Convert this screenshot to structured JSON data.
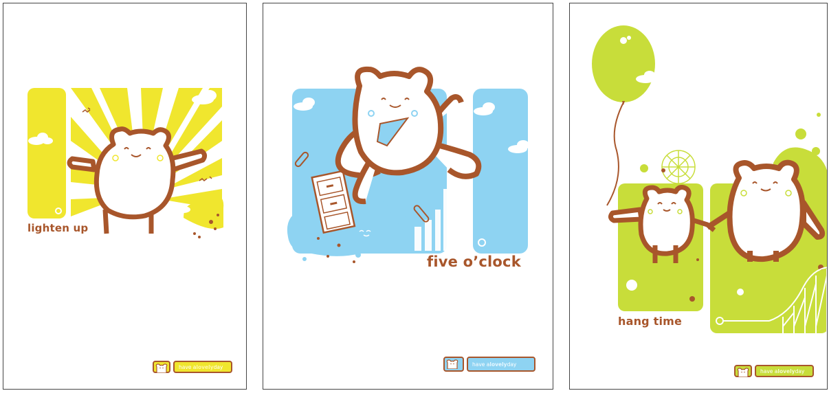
{
  "cards": [
    {
      "caption": "lighten up",
      "footer": {
        "pre": "have a ",
        "highlight": "lovely",
        "post": " day"
      },
      "accent": "#f0e62e"
    },
    {
      "caption": "five o’clock",
      "footer": {
        "pre": "have a ",
        "highlight": "lovely",
        "post": " day"
      },
      "accent": "#8ed3f2"
    },
    {
      "caption": "hang time",
      "footer": {
        "pre": "have a ",
        "highlight": "lovely",
        "post": " day"
      },
      "accent": "#c8dd3a"
    }
  ],
  "colors": {
    "outline": "#a8562b",
    "yellow": "#f0e62e",
    "blue": "#8ed3f2",
    "green": "#c8dd3a",
    "white": "#ffffff"
  }
}
